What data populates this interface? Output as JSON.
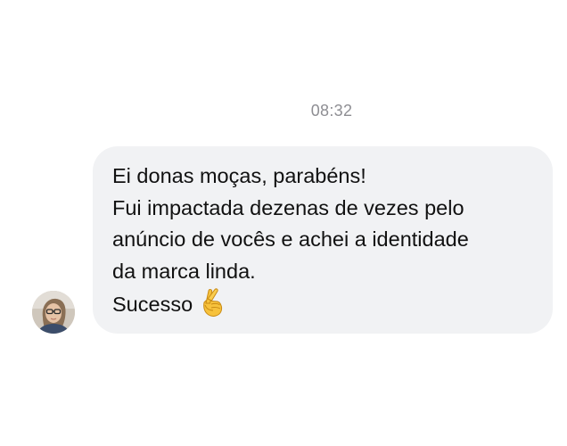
{
  "conversation": {
    "timestamp": "08:32",
    "message": {
      "lines": [
        "Ei donas moças, parabéns!",
        "Fui impactada dezenas de vezes pelo",
        "anúncio de vocês e achei a identidade",
        "da marca linda.",
        "Sucesso"
      ],
      "emoji": "crossed-fingers-emoji"
    },
    "sender": {
      "avatar": "profile-photo"
    }
  },
  "colors": {
    "bubble_background": "#f1f2f4",
    "timestamp_text": "#8e8e93",
    "message_text": "#111111"
  }
}
